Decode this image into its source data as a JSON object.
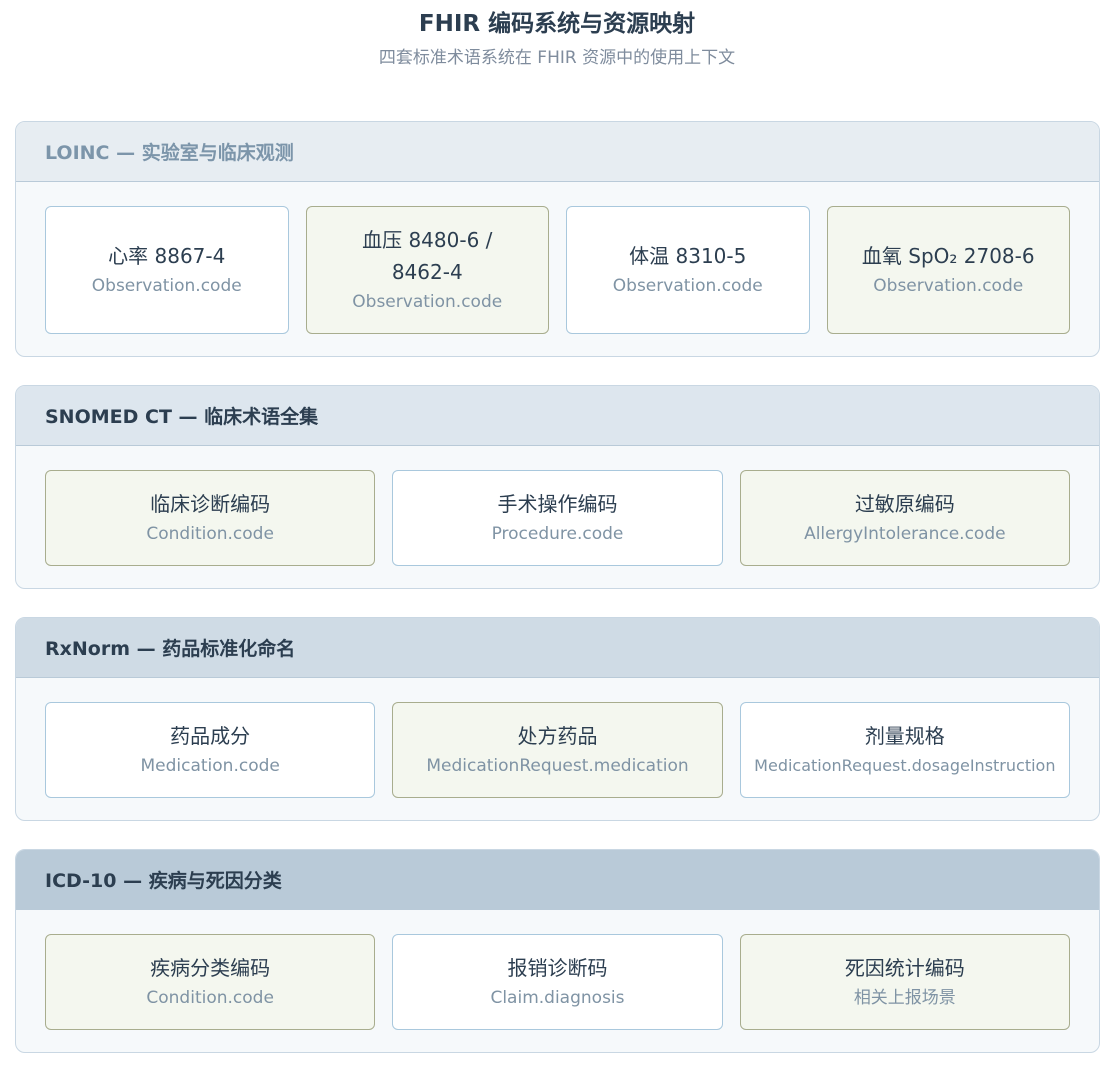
{
  "header": {
    "title": "FHIR 编码系统与资源映射",
    "subtitle": "四套标准术语系统在 FHIR 资源中的使用上下文"
  },
  "sections": [
    {
      "title": "LOINC — 实验室与临床观测",
      "head_bg": "#e7edf2",
      "head_color": "#7c95aa",
      "cards": [
        {
          "title": "心率 8867-4",
          "sub": "Observation.code",
          "style": "white"
        },
        {
          "title": "血压 8480-6 / 8462-4",
          "sub": "Observation.code",
          "style": "green"
        },
        {
          "title": "体温 8310-5",
          "sub": "Observation.code",
          "style": "white"
        },
        {
          "title": "血氧 SpO₂ 2708-6",
          "sub": "Observation.code",
          "style": "green"
        }
      ]
    },
    {
      "title": "SNOMED CT — 临床术语全集",
      "head_bg": "#dde6ee",
      "head_color": "#2c3e50",
      "cards": [
        {
          "title": "临床诊断编码",
          "sub": "Condition.code",
          "style": "green"
        },
        {
          "title": "手术操作编码",
          "sub": "Procedure.code",
          "style": "white"
        },
        {
          "title": "过敏原编码",
          "sub": "AllergyIntolerance.code",
          "style": "green"
        }
      ]
    },
    {
      "title": "RxNorm — 药品标准化命名",
      "head_bg": "#cfdbe5",
      "head_color": "#2c3e50",
      "cards": [
        {
          "title": "药品成分",
          "sub": "Medication.code",
          "style": "white"
        },
        {
          "title": "处方药品",
          "sub": "MedicationRequest.medication",
          "style": "green"
        },
        {
          "title": "剂量规格",
          "sub": "MedicationRequest.dosageInstruction",
          "style": "white"
        }
      ]
    },
    {
      "title": "ICD-10 — 疾病与死因分类",
      "head_bg": "#b9cad8",
      "head_color": "#2c3e50",
      "cards": [
        {
          "title": "疾病分类编码",
          "sub": "Condition.code",
          "style": "green"
        },
        {
          "title": "报销诊断码",
          "sub": "Claim.diagnosis",
          "style": "white"
        },
        {
          "title": "死因统计编码",
          "sub": "相关上报场景",
          "style": "green"
        }
      ]
    }
  ]
}
